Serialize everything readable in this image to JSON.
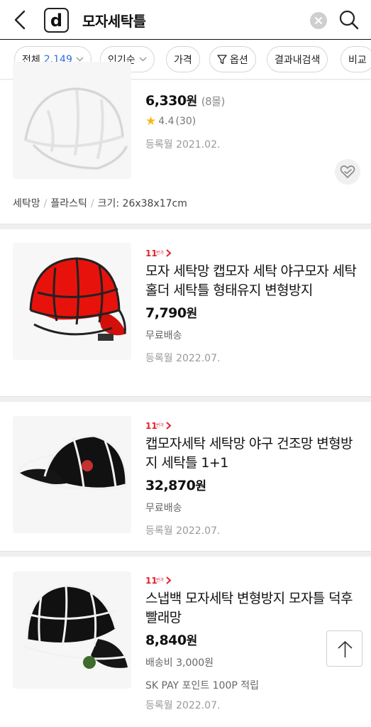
{
  "header": {
    "logo_letter": "d",
    "search_query": "모자세탁틀"
  },
  "filters": {
    "all_label": "전체",
    "all_count": "2,149",
    "sort_label": "인기순",
    "price_label": "가격",
    "option_label": "옵션",
    "in_result_label": "결과내검색",
    "compare_label": "비교"
  },
  "products": [
    {
      "price": "6,330",
      "won": "원",
      "malls": "(8몰)",
      "rating": "4.4",
      "reviews": "(30)",
      "date": "등록월 2021.02.",
      "specs": [
        "세탁망",
        "플라스틱",
        "크기: 26x38x17cm"
      ]
    },
    {
      "badge": "11번가",
      "title": "모자 세탁망 캡모자 세탁 야구모자 세탁홀더 세탁틀 형태유지 변형방지",
      "price": "7,790",
      "won": "원",
      "shipping": "무료배송",
      "date": "등록월 2022.07."
    },
    {
      "badge": "11번가",
      "title": "캡모자세탁 세탁망 야구 건조망 변형방지 세탁틀 1+1",
      "price": "32,870",
      "won": "원",
      "shipping": "무료배송",
      "date": "등록월 2022.07."
    },
    {
      "badge": "11번가",
      "title": "스냅백 모자세탁 변형방지 모자틀 덕후 빨래망",
      "price": "8,840",
      "won": "원",
      "shipping": "배송비 3,000원",
      "points": "SK PAY 포인트 100P 적립",
      "date": "등록월 2022.07."
    }
  ],
  "colors": {
    "accent_blue": "#2d6fd8",
    "badge_red": "#e5202e",
    "star": "#f6b81a"
  }
}
